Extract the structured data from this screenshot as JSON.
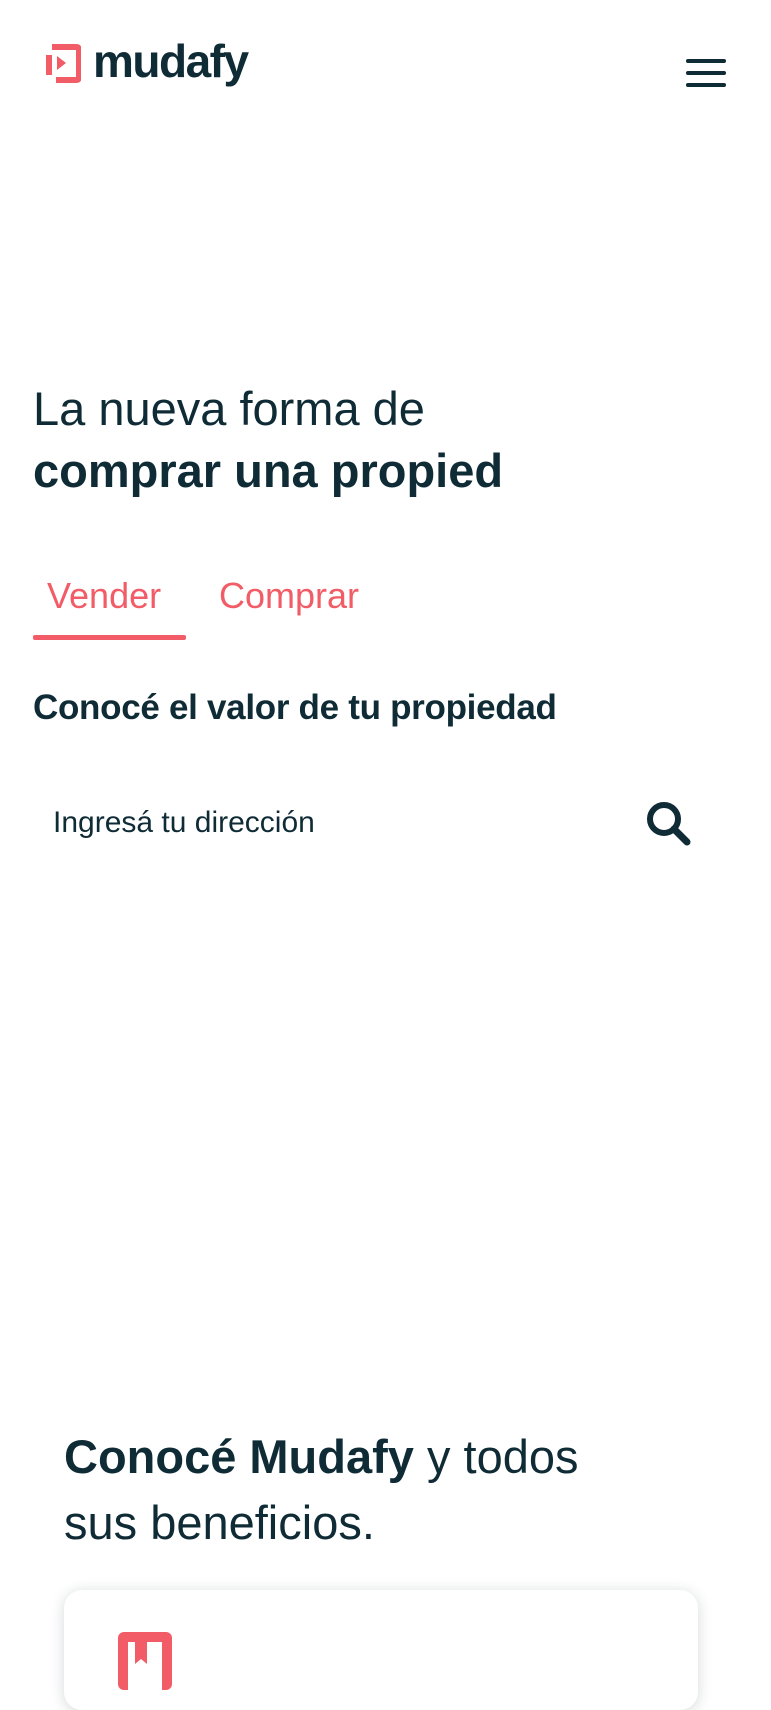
{
  "brand": {
    "name": "mudafy",
    "accent": "#f25c66",
    "dark": "#0f2b35"
  },
  "header": {
    "menu_icon": "hamburger-menu-icon"
  },
  "hero": {
    "title_line1": "La nueva forma de",
    "title_line2": "comprar una propied",
    "tabs": [
      {
        "label": "Vender",
        "active": true
      },
      {
        "label": "Comprar",
        "active": false
      }
    ],
    "subtitle": "Conocé el valor de tu propiedad",
    "search": {
      "placeholder": "Ingresá tu dirección",
      "value": "",
      "icon": "search-icon"
    }
  },
  "benefits": {
    "title_bold": "Conocé Mudafy",
    "title_rest": " y todos",
    "title_line2": "sus beneficios.",
    "card_icon": "bookmark-book-icon"
  }
}
